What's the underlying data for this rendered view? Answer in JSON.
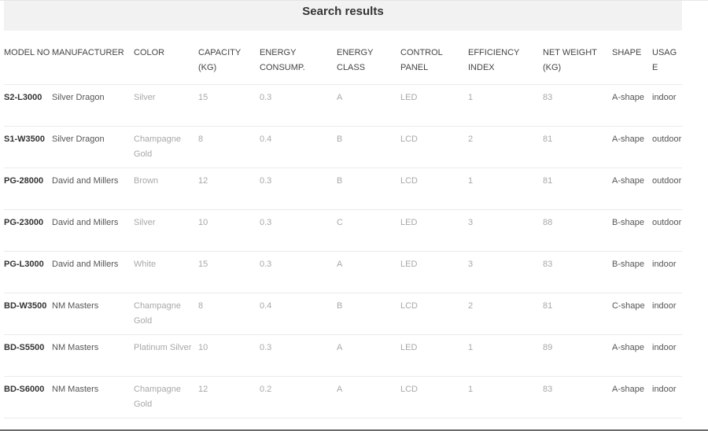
{
  "header": {
    "title": "Search results"
  },
  "table": {
    "columns": [
      "MODEL NO",
      "MANUFACTURER",
      "COLOR",
      "CAPACITY (KG)",
      "ENERGY CONSUMP.",
      "ENERGY CLASS",
      "CONTROL PANEL",
      "EFFICIENCY INDEX",
      "NET WEIGHT (KG)",
      "SHAPE",
      "USAGE"
    ],
    "rows": [
      [
        "S2-L3000",
        "Silver Dragon",
        "Silver",
        "15",
        "0.3",
        "A",
        "LED",
        "1",
        "83",
        "A-shape",
        "indoor"
      ],
      [
        "S1-W3500",
        "Silver Dragon",
        "Champagne Gold",
        "8",
        "0.4",
        "B",
        "LCD",
        "2",
        "81",
        "A-shape",
        "outdoor"
      ],
      [
        "PG-28000",
        "David and Millers",
        "Brown",
        "12",
        "0.3",
        "B",
        "LCD",
        "1",
        "81",
        "A-shape",
        "outdoor"
      ],
      [
        "PG-23000",
        "David and Millers",
        "Silver",
        "10",
        "0.3",
        "C",
        "LED",
        "3",
        "88",
        "B-shape",
        "outdoor"
      ],
      [
        "PG-L3000",
        "David and Millers",
        "White",
        "15",
        "0.3",
        "A",
        "LED",
        "3",
        "83",
        "B-shape",
        "indoor"
      ],
      [
        "BD-W3500",
        "NM Masters",
        "Champagne Gold",
        "8",
        "0.4",
        "B",
        "LCD",
        "2",
        "81",
        "C-shape",
        "indoor"
      ],
      [
        "BD-S5500",
        "NM Masters",
        "Platinum Silver",
        "10",
        "0.3",
        "A",
        "LED",
        "1",
        "89",
        "A-shape",
        "indoor"
      ],
      [
        "BD-S6000",
        "NM Masters",
        "Champagne Gold",
        "12",
        "0.2",
        "A",
        "LCD",
        "1",
        "83",
        "A-shape",
        "indoor"
      ]
    ]
  }
}
